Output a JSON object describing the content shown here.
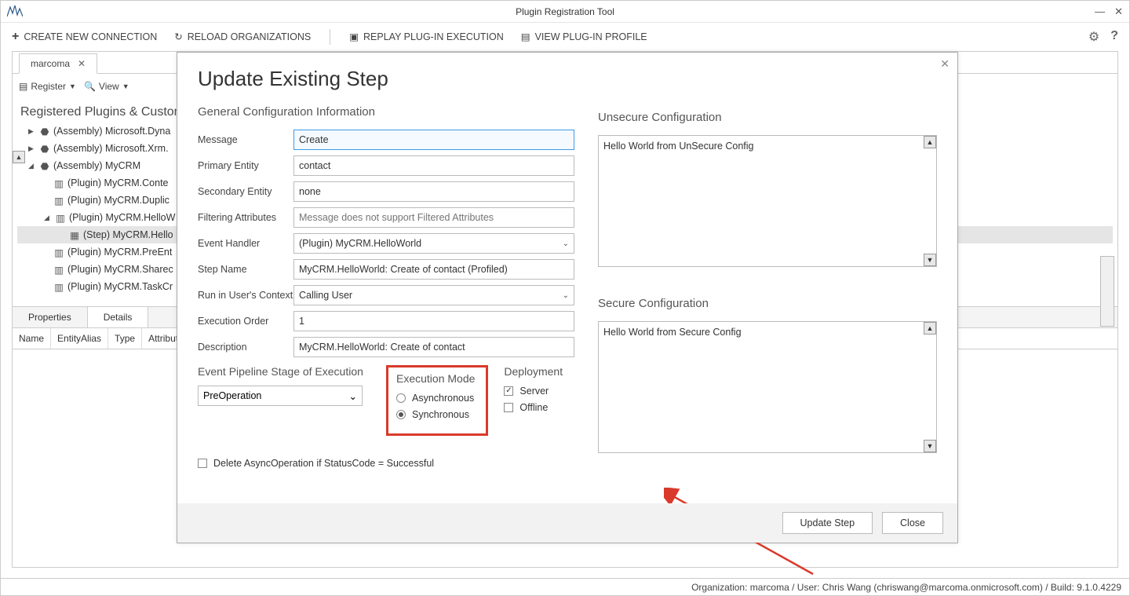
{
  "window": {
    "title": "Plugin Registration Tool"
  },
  "toolbar": {
    "create": "CREATE NEW CONNECTION",
    "reload": "RELOAD ORGANIZATIONS",
    "replay": "REPLAY PLUG-IN EXECUTION",
    "profile": "VIEW PLUG-IN PROFILE"
  },
  "tab": {
    "name": "marcoma"
  },
  "innerbar": {
    "register": "Register",
    "view": "View"
  },
  "side": {
    "title": "Registered Plugins & Custom"
  },
  "tree": {
    "n0": "(Assembly) Microsoft.Dyna",
    "n1": "(Assembly) Microsoft.Xrm.",
    "n2": "(Assembly) MyCRM",
    "n3": "(Plugin) MyCRM.Conte",
    "n4": "(Plugin) MyCRM.Duplic",
    "n5": "(Plugin) MyCRM.HelloW",
    "n6": "(Step) MyCRM.Hello",
    "n7": "(Plugin) MyCRM.PreEnt",
    "n8": "(Plugin) MyCRM.Sharec",
    "n9": "(Plugin) MyCRM.TaskCr"
  },
  "dtabs": {
    "props": "Properties",
    "details": "Details"
  },
  "grid": {
    "c0": "Name",
    "c1": "EntityAlias",
    "c2": "Type",
    "c3": "Attributes"
  },
  "dialog": {
    "title": "Update Existing Step",
    "h_general": "General Configuration Information",
    "h_unsecure": "Unsecure  Configuration",
    "h_secure": "Secure  Configuration",
    "l_message": "Message",
    "v_message": "Create",
    "l_primary": "Primary Entity",
    "v_primary": "contact",
    "l_secondary": "Secondary Entity",
    "v_secondary": "none",
    "l_filter": "Filtering Attributes",
    "ph_filter": "Message does not support Filtered Attributes",
    "l_handler": "Event Handler",
    "v_handler": "(Plugin) MyCRM.HelloWorld",
    "l_stepname": "Step Name",
    "v_stepname": "MyCRM.HelloWorld: Create of contact (Profiled)",
    "l_context": "Run in User's Context",
    "v_context": "Calling User",
    "l_order": "Execution Order",
    "v_order": "1",
    "l_desc": "Description",
    "v_desc": "MyCRM.HelloWorld: Create of contact",
    "h_stage": "Event Pipeline Stage of Execution",
    "v_stage": "PreOperation",
    "h_execmode": "Execution Mode",
    "r_async": "Asynchronous",
    "r_sync": "Synchronous",
    "h_deploy": "Deployment",
    "c_server": "Server",
    "c_offline": "Offline",
    "chk_delete": "Delete AsyncOperation if StatusCode = Successful",
    "unsecure_text": "Hello World from UnSecure Config",
    "secure_text": "Hello World from Secure Config",
    "btn_update": "Update Step",
    "btn_close": "Close"
  },
  "status": "Organization: marcoma / User: Chris Wang (chriswang@marcoma.onmicrosoft.com) / Build: 9.1.0.4229"
}
